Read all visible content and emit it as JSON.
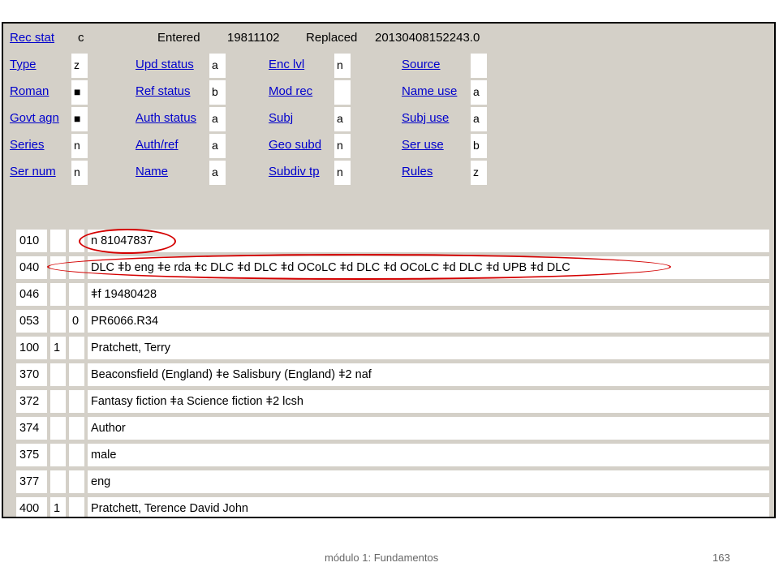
{
  "header": {
    "rec_stat_label": "Rec stat",
    "rec_stat_value": "c",
    "entered_label": "Entered",
    "entered_value": "19811102",
    "replaced_label": "Replaced",
    "replaced_value": "20130408152243.0"
  },
  "fixed_fields": [
    {
      "label": "Type",
      "value": "z"
    },
    {
      "label": "Upd status",
      "value": "a"
    },
    {
      "label": "Enc lvl",
      "value": "n"
    },
    {
      "label": "Source",
      "value": ""
    },
    {
      "label": "Roman",
      "value": "■"
    },
    {
      "label": "Ref status",
      "value": "b"
    },
    {
      "label": "Mod rec",
      "value": ""
    },
    {
      "label": "Name use",
      "value": "a"
    },
    {
      "label": "Govt agn",
      "value": "■"
    },
    {
      "label": "Auth status",
      "value": "a"
    },
    {
      "label": "Subj",
      "value": "a"
    },
    {
      "label": "Subj use",
      "value": "a"
    },
    {
      "label": "Series",
      "value": "n"
    },
    {
      "label": "Auth/ref",
      "value": "a"
    },
    {
      "label": "Geo subd",
      "value": "n"
    },
    {
      "label": "Ser use",
      "value": "b"
    },
    {
      "label": "Ser num",
      "value": "n"
    },
    {
      "label": "Name",
      "value": "a"
    },
    {
      "label": "Subdiv tp",
      "value": "n"
    },
    {
      "label": "Rules",
      "value": "z"
    }
  ],
  "variable_fields": [
    {
      "tag": "010",
      "ind1": "",
      "ind2": "",
      "data": "n  81047837"
    },
    {
      "tag": "040",
      "ind1": "",
      "ind2": "",
      "data": "DLC ǂb eng ǂe rda ǂc DLC ǂd DLC ǂd OCoLC ǂd DLC ǂd OCoLC ǂd DLC ǂd UPB ǂd DLC"
    },
    {
      "tag": "046",
      "ind1": "",
      "ind2": "",
      "data": "ǂf 19480428"
    },
    {
      "tag": "053",
      "ind1": "",
      "ind2": "0",
      "data": "PR6066.R34"
    },
    {
      "tag": "100",
      "ind1": "1",
      "ind2": "",
      "data": "Pratchett, Terry"
    },
    {
      "tag": "370",
      "ind1": "",
      "ind2": "",
      "data": "Beaconsfield (England) ǂe Salisbury (England) ǂ2 naf"
    },
    {
      "tag": "372",
      "ind1": "",
      "ind2": "",
      "data": "Fantasy fiction ǂa Science fiction ǂ2 lcsh"
    },
    {
      "tag": "374",
      "ind1": "",
      "ind2": "",
      "data": "Author"
    },
    {
      "tag": "375",
      "ind1": "",
      "ind2": "",
      "data": "male"
    },
    {
      "tag": "377",
      "ind1": "",
      "ind2": "",
      "data": "eng"
    },
    {
      "tag": "400",
      "ind1": "1",
      "ind2": "",
      "data": "Pratchett, Terence David John"
    }
  ],
  "highlight_color": "#d40000",
  "footer": {
    "text": "módulo 1: Fundamentos",
    "page": "163"
  }
}
